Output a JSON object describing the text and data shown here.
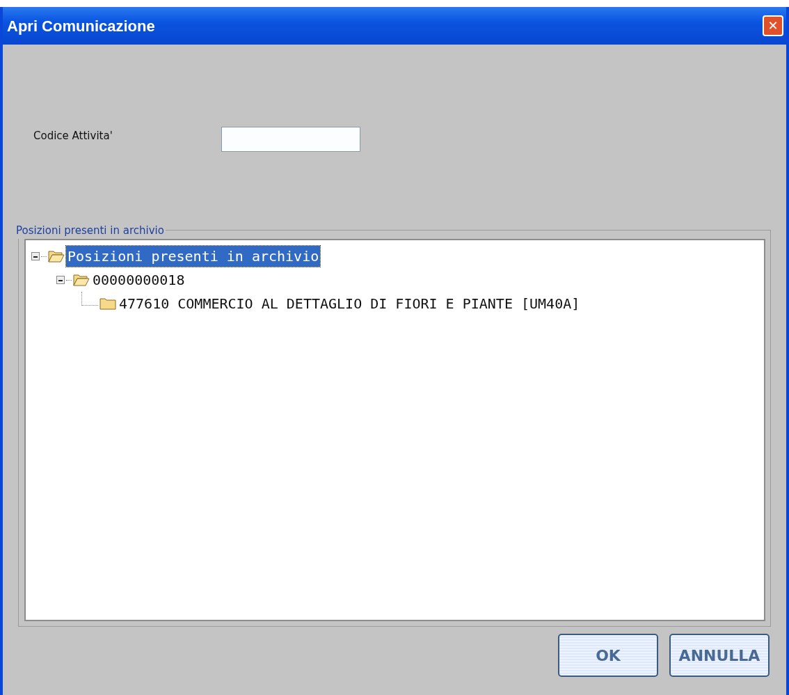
{
  "window": {
    "title": "Apri Comunicazione",
    "close": "✕"
  },
  "form": {
    "label": "Codice Attivita'"
  },
  "group": {
    "title": "Posizioni presenti in archivio",
    "tree": [
      {
        "label": "Posizioni presenti in archivio",
        "expanded": true,
        "selected": true,
        "children": [
          {
            "label": "00000000018",
            "expanded": true,
            "selected": false,
            "children": [
              {
                "label": "477610 COMMERCIO AL DETTAGLIO DI FIORI E PIANTE [UM40A]",
                "selected": false
              }
            ]
          }
        ]
      }
    ]
  },
  "buttons": [
    "OK",
    "ANNULLA"
  ]
}
